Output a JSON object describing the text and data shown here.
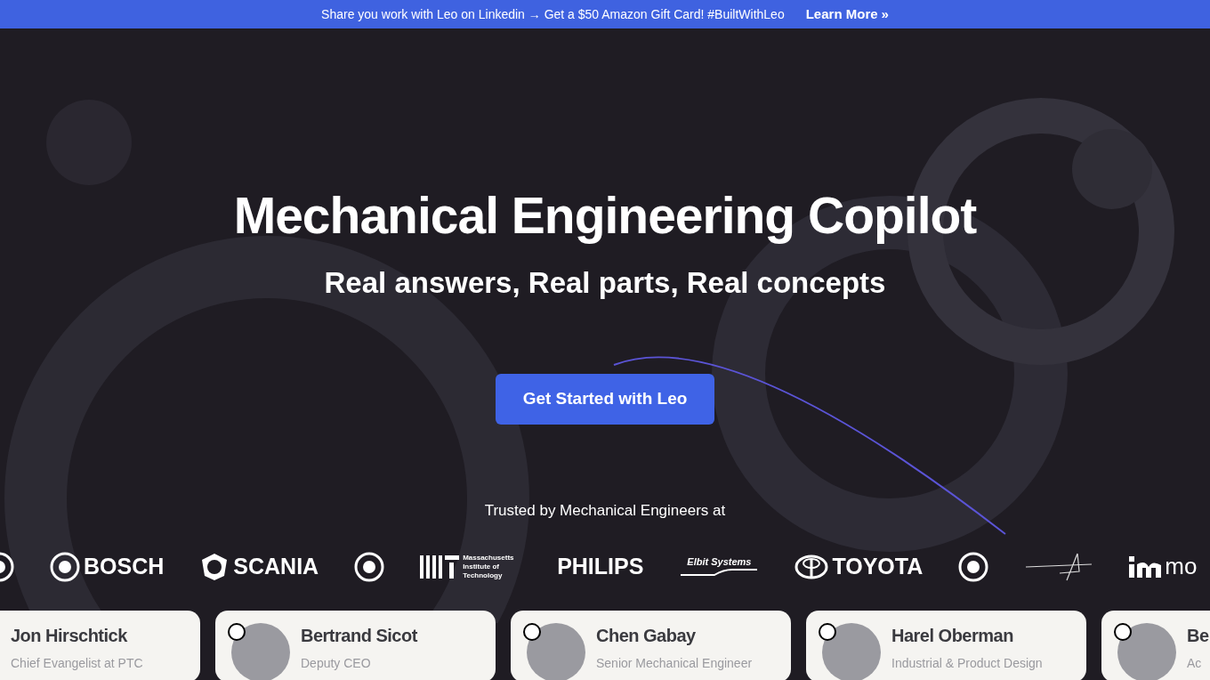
{
  "banner": {
    "text": "Share you work with Leo on Linkedin → Get a $50 Amazon Gift Card!  #BuiltWithLeo",
    "link": "Learn More",
    "link_icon": "»"
  },
  "hero": {
    "title": "Mechanical Engineering Copilot",
    "subtitle": "Real answers, Real parts, Real concepts",
    "cta": "Get Started with Leo"
  },
  "trusted": {
    "heading": "Trusted by Mechanical Engineers at",
    "logos": [
      {
        "kind": "circle"
      },
      {
        "kind": "circle",
        "text": "BOSCH"
      },
      {
        "kind": "shield",
        "text": "SCANIA"
      },
      {
        "kind": "circle"
      },
      {
        "kind": "bars",
        "text": "Massachusetts Institute of Technology"
      },
      {
        "kind": "none",
        "text": "PHILIPS"
      },
      {
        "kind": "swoosh",
        "text": "Elbit Systems"
      },
      {
        "kind": "oval",
        "text": "TOYOTA"
      },
      {
        "kind": "circle"
      },
      {
        "kind": "star"
      },
      {
        "kind": "m",
        "text": "mo"
      }
    ]
  },
  "testimonials": [
    {
      "name": "Jon Hirschtick",
      "role": "Chief Evangelist at PTC",
      "avatar": false
    },
    {
      "name": "Bertrand Sicot",
      "role": "Deputy CEO",
      "avatar": true
    },
    {
      "name": "Chen Gabay",
      "role": "Senior Mechanical Engineer",
      "avatar": true
    },
    {
      "name": "Harel Oberman",
      "role": "Industrial & Product Design",
      "avatar": true
    },
    {
      "name": "Be",
      "role": "Ac",
      "avatar": true
    }
  ]
}
